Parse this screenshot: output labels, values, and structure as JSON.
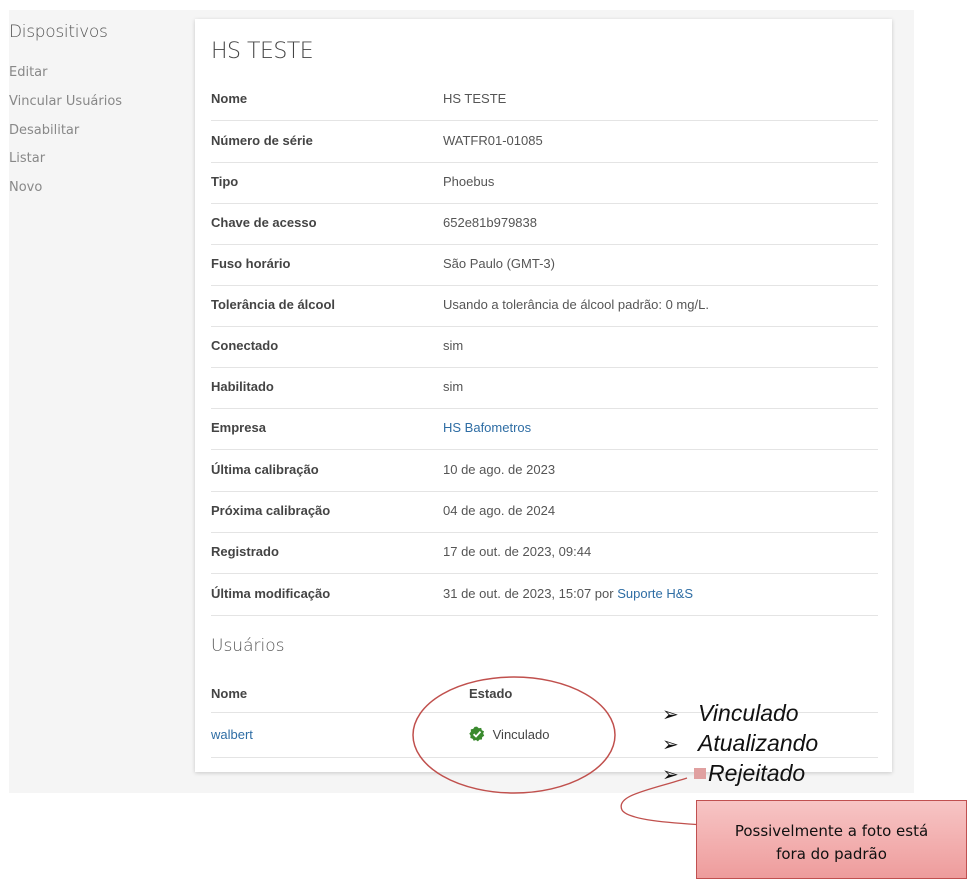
{
  "sidebar": {
    "title": "Dispositivos",
    "items": [
      {
        "label": "Editar"
      },
      {
        "label": "Vincular Usuários"
      },
      {
        "label": "Desabilitar"
      },
      {
        "label": "Listar"
      },
      {
        "label": "Novo"
      }
    ]
  },
  "device": {
    "title": "HS TESTE",
    "fields": [
      {
        "label": "Nome",
        "value": "HS TESTE"
      },
      {
        "label": "Número de série",
        "value": "WATFR01-01085"
      },
      {
        "label": "Tipo",
        "value": "Phoebus"
      },
      {
        "label": "Chave de acesso",
        "value": "652e81b979838"
      },
      {
        "label": "Fuso horário",
        "value": "São Paulo (GMT-3)"
      },
      {
        "label": "Tolerância de álcool",
        "value": "Usando a tolerância de álcool padrão: 0 mg/L."
      },
      {
        "label": "Conectado",
        "value": "sim"
      },
      {
        "label": "Habilitado",
        "value": "sim"
      },
      {
        "label": "Empresa",
        "value": "HS Bafometros"
      },
      {
        "label": "Última calibração",
        "value": "10 de ago. de 2023"
      },
      {
        "label": "Próxima calibração",
        "value": "04 de ago. de 2024"
      },
      {
        "label": "Registrado",
        "value": "17 de out. de 2023, 09:44"
      },
      {
        "label": "Última modificação",
        "value": "31 de out. de 2023, 15:07 por",
        "link": "Suporte H&S"
      }
    ]
  },
  "users": {
    "title": "Usuários",
    "col_name": "Nome",
    "col_state": "Estado",
    "rows": [
      {
        "name": "walbert",
        "state": "Vinculado"
      }
    ]
  },
  "annotation": {
    "bullets": [
      "Vinculado",
      "Atualizando",
      "Rejeitado"
    ],
    "callout_line1": "Possivelmente a foto está",
    "callout_line2": "fora do padrão"
  },
  "colors": {
    "link": "#2e6da4",
    "check": "#3a8a2e",
    "annotation_circle": "#c0504d",
    "callout_fill": "#f2b0b0"
  }
}
